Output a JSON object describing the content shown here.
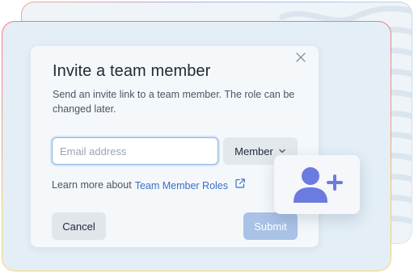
{
  "dialog": {
    "title": "Invite a team member",
    "description": "Send an invite link to a team member. The role can be changed later.",
    "email_placeholder": "Email address",
    "email_value": "",
    "role_selected": "Member",
    "learn_more_prefix": "Learn more about",
    "learn_more_link": "Team Member Roles",
    "cancel_label": "Cancel",
    "submit_label": "Submit"
  },
  "icons": {
    "close": "close-icon",
    "chevron": "chevron-down-icon",
    "external": "external-link-icon",
    "add_user": "add-user-icon"
  },
  "colors": {
    "link": "#3a6fc4",
    "submit_disabled": "#a9c2e6",
    "avatar": "#6b7be0",
    "input_focus": "#8fb4e6"
  }
}
